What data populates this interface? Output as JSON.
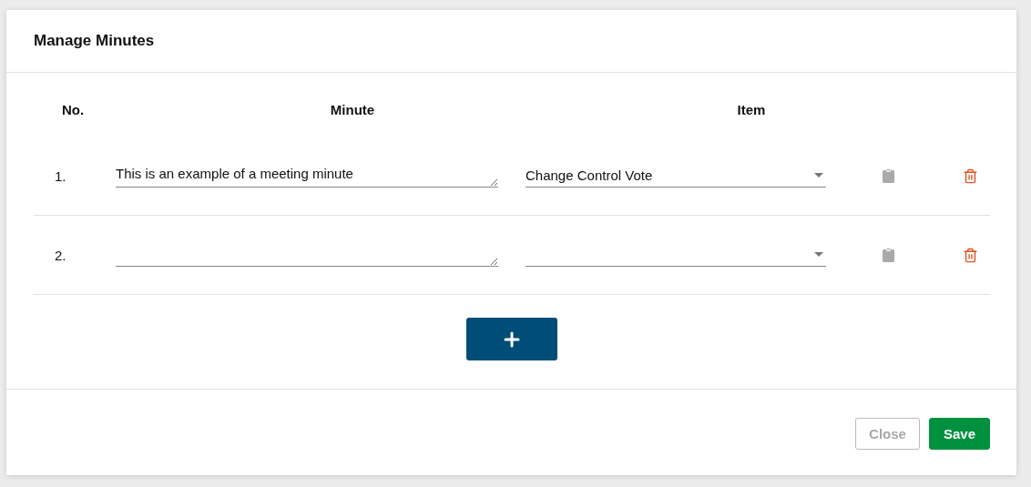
{
  "dialog": {
    "title": "Manage Minutes"
  },
  "table": {
    "columns": [
      "No.",
      "Minute",
      "Item"
    ],
    "rows": [
      {
        "number": "1.",
        "minute": "This is an example of a meeting minute",
        "item": "Change Control Vote"
      },
      {
        "number": "2."
      }
    ]
  },
  "footer": {
    "buttons": [
      {
        "label": "Close",
        "kind": "secondary",
        "disabled": true
      },
      {
        "label": "Save",
        "kind": "primary",
        "disabled": false
      }
    ]
  }
}
